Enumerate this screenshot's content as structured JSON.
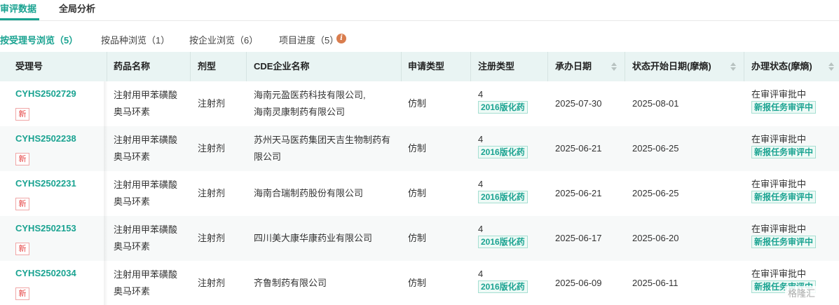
{
  "top_tabs": [
    {
      "label": "审评数据",
      "active": true
    },
    {
      "label": "全局分析",
      "active": false
    }
  ],
  "sub_tabs": [
    {
      "label": "按受理号浏览（5）",
      "active": true
    },
    {
      "label": "按品种浏览（1）",
      "active": false
    },
    {
      "label": "按企业浏览（6）",
      "active": false
    },
    {
      "label": "项目进度（5）",
      "active": false
    }
  ],
  "info_icon": {
    "name": "info-icon",
    "glyph": "i",
    "color": "#d97d4e"
  },
  "accent_color": "#1aa391",
  "table": {
    "columns": [
      "受理号",
      "药品名称",
      "剂型",
      "CDE企业名称",
      "申请类型",
      "注册类型",
      "承办日期",
      "状态开始日期(摩熵)",
      "办理状态(摩熵)"
    ],
    "sortable": [
      "承办日期",
      "状态开始日期(摩熵)",
      "办理状态(摩熵)"
    ],
    "new_badge": "新",
    "rows": [
      {
        "accept_no": "CYHS2502729",
        "drug_name": [
          "注射用甲苯磺酸",
          "奥马环素"
        ],
        "dosage_form": "注射剂",
        "company": [
          "海南元盈医药科技有限公司,",
          "海南灵康制药有限公司"
        ],
        "apply_type": "仿制",
        "reg_num": "4",
        "reg_tag": "2016版化药",
        "accept_date": "2025-07-30",
        "status_start": "2025-08-01",
        "status": "在审评审批中",
        "status_tag": "新报任务审评中"
      },
      {
        "accept_no": "CYHS2502238",
        "drug_name": [
          "注射用甲苯磺酸",
          "奥马环素"
        ],
        "dosage_form": "注射剂",
        "company": [
          "苏州天马医药集团天吉生物制药有",
          "限公司"
        ],
        "apply_type": "仿制",
        "reg_num": "4",
        "reg_tag": "2016版化药",
        "accept_date": "2025-06-21",
        "status_start": "2025-06-25",
        "status": "在审评审批中",
        "status_tag": "新报任务审评中"
      },
      {
        "accept_no": "CYHS2502231",
        "drug_name": [
          "注射用甲苯磺酸",
          "奥马环素"
        ],
        "dosage_form": "注射剂",
        "company": [
          "海南合瑞制药股份有限公司"
        ],
        "apply_type": "仿制",
        "reg_num": "4",
        "reg_tag": "2016版化药",
        "accept_date": "2025-06-21",
        "status_start": "2025-06-25",
        "status": "在审评审批中",
        "status_tag": "新报任务审评中"
      },
      {
        "accept_no": "CYHS2502153",
        "drug_name": [
          "注射用甲苯磺酸",
          "奥马环素"
        ],
        "dosage_form": "注射剂",
        "company": [
          "四川美大康华康药业有限公司"
        ],
        "apply_type": "仿制",
        "reg_num": "4",
        "reg_tag": "2016版化药",
        "accept_date": "2025-06-17",
        "status_start": "2025-06-20",
        "status": "在审评审批中",
        "status_tag": "新报任务审评中"
      },
      {
        "accept_no": "CYHS2502034",
        "drug_name": [
          "注射用甲苯磺酸",
          "奥马环素"
        ],
        "dosage_form": "注射剂",
        "company": [
          "齐鲁制药有限公司"
        ],
        "apply_type": "仿制",
        "reg_num": "4",
        "reg_tag": "2016版化药",
        "accept_date": "2025-06-09",
        "status_start": "2025-06-11",
        "status": "在审评审批中",
        "status_tag": "新报任务审评中"
      }
    ]
  },
  "watermark": "格隆汇"
}
